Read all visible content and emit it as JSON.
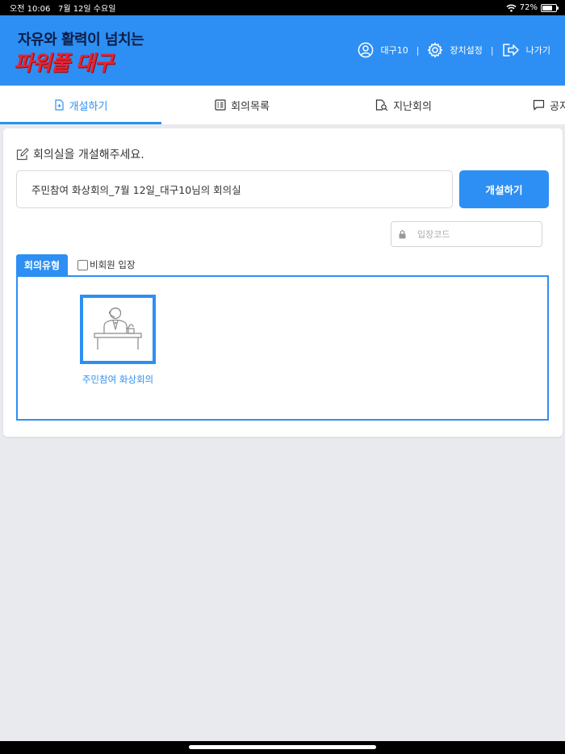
{
  "status_bar": {
    "time": "오전 10:06",
    "date": "7월 12일 수요일",
    "battery": "72%",
    "battery_level": 0.72
  },
  "header": {
    "logo_line1": "자유와 활력이 넘치는",
    "logo_line2": "파워풀 대구",
    "user_label": "대구10",
    "separator": "|",
    "settings_label": "장치설정",
    "exit_label": "나가기"
  },
  "tabs": [
    {
      "label": "개설하기",
      "icon": "file-plus-icon",
      "active": true
    },
    {
      "label": "회의목록",
      "icon": "list-icon",
      "active": false
    },
    {
      "label": "지난회의",
      "icon": "document-search-icon",
      "active": false
    },
    {
      "label": "공지",
      "icon": "chat-bubble-icon",
      "active": false
    }
  ],
  "create": {
    "title": "회의실을 개설해주세요.",
    "room_name_value": "주민참여 화상회의_7월 12일_대구10님의 회의실",
    "open_button": "개설하기",
    "entry_code_placeholder": "입장코드"
  },
  "meeting_type": {
    "tab_label": "회의유형",
    "guest_entry_label": "비회원 입장",
    "guest_entry_checked": false,
    "items": [
      {
        "label": "주민참여 화상회의",
        "icon": "speaker-podium-icon"
      }
    ]
  },
  "colors": {
    "primary": "#2d8ff3",
    "logo_dark": "#0d1c46",
    "logo_red": "#e8232e",
    "background": "#e9eaee"
  }
}
